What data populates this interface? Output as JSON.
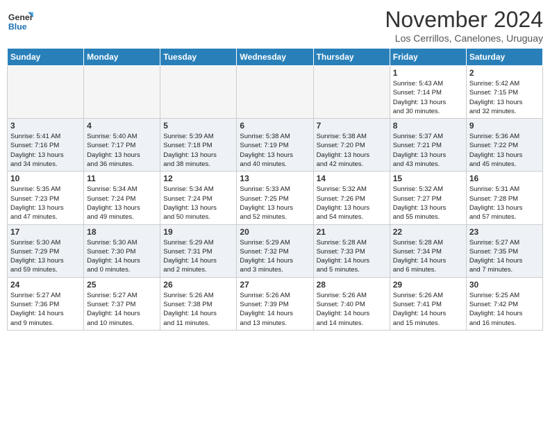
{
  "header": {
    "logo_line1": "General",
    "logo_line2": "Blue",
    "month": "November 2024",
    "location": "Los Cerrillos, Canelones, Uruguay"
  },
  "weekdays": [
    "Sunday",
    "Monday",
    "Tuesday",
    "Wednesday",
    "Thursday",
    "Friday",
    "Saturday"
  ],
  "weeks": [
    [
      {
        "day": "",
        "info": ""
      },
      {
        "day": "",
        "info": ""
      },
      {
        "day": "",
        "info": ""
      },
      {
        "day": "",
        "info": ""
      },
      {
        "day": "",
        "info": ""
      },
      {
        "day": "1",
        "info": "Sunrise: 5:43 AM\nSunset: 7:14 PM\nDaylight: 13 hours\nand 30 minutes."
      },
      {
        "day": "2",
        "info": "Sunrise: 5:42 AM\nSunset: 7:15 PM\nDaylight: 13 hours\nand 32 minutes."
      }
    ],
    [
      {
        "day": "3",
        "info": "Sunrise: 5:41 AM\nSunset: 7:16 PM\nDaylight: 13 hours\nand 34 minutes."
      },
      {
        "day": "4",
        "info": "Sunrise: 5:40 AM\nSunset: 7:17 PM\nDaylight: 13 hours\nand 36 minutes."
      },
      {
        "day": "5",
        "info": "Sunrise: 5:39 AM\nSunset: 7:18 PM\nDaylight: 13 hours\nand 38 minutes."
      },
      {
        "day": "6",
        "info": "Sunrise: 5:38 AM\nSunset: 7:19 PM\nDaylight: 13 hours\nand 40 minutes."
      },
      {
        "day": "7",
        "info": "Sunrise: 5:38 AM\nSunset: 7:20 PM\nDaylight: 13 hours\nand 42 minutes."
      },
      {
        "day": "8",
        "info": "Sunrise: 5:37 AM\nSunset: 7:21 PM\nDaylight: 13 hours\nand 43 minutes."
      },
      {
        "day": "9",
        "info": "Sunrise: 5:36 AM\nSunset: 7:22 PM\nDaylight: 13 hours\nand 45 minutes."
      }
    ],
    [
      {
        "day": "10",
        "info": "Sunrise: 5:35 AM\nSunset: 7:23 PM\nDaylight: 13 hours\nand 47 minutes."
      },
      {
        "day": "11",
        "info": "Sunrise: 5:34 AM\nSunset: 7:24 PM\nDaylight: 13 hours\nand 49 minutes."
      },
      {
        "day": "12",
        "info": "Sunrise: 5:34 AM\nSunset: 7:24 PM\nDaylight: 13 hours\nand 50 minutes."
      },
      {
        "day": "13",
        "info": "Sunrise: 5:33 AM\nSunset: 7:25 PM\nDaylight: 13 hours\nand 52 minutes."
      },
      {
        "day": "14",
        "info": "Sunrise: 5:32 AM\nSunset: 7:26 PM\nDaylight: 13 hours\nand 54 minutes."
      },
      {
        "day": "15",
        "info": "Sunrise: 5:32 AM\nSunset: 7:27 PM\nDaylight: 13 hours\nand 55 minutes."
      },
      {
        "day": "16",
        "info": "Sunrise: 5:31 AM\nSunset: 7:28 PM\nDaylight: 13 hours\nand 57 minutes."
      }
    ],
    [
      {
        "day": "17",
        "info": "Sunrise: 5:30 AM\nSunset: 7:29 PM\nDaylight: 13 hours\nand 59 minutes."
      },
      {
        "day": "18",
        "info": "Sunrise: 5:30 AM\nSunset: 7:30 PM\nDaylight: 14 hours\nand 0 minutes."
      },
      {
        "day": "19",
        "info": "Sunrise: 5:29 AM\nSunset: 7:31 PM\nDaylight: 14 hours\nand 2 minutes."
      },
      {
        "day": "20",
        "info": "Sunrise: 5:29 AM\nSunset: 7:32 PM\nDaylight: 14 hours\nand 3 minutes."
      },
      {
        "day": "21",
        "info": "Sunrise: 5:28 AM\nSunset: 7:33 PM\nDaylight: 14 hours\nand 5 minutes."
      },
      {
        "day": "22",
        "info": "Sunrise: 5:28 AM\nSunset: 7:34 PM\nDaylight: 14 hours\nand 6 minutes."
      },
      {
        "day": "23",
        "info": "Sunrise: 5:27 AM\nSunset: 7:35 PM\nDaylight: 14 hours\nand 7 minutes."
      }
    ],
    [
      {
        "day": "24",
        "info": "Sunrise: 5:27 AM\nSunset: 7:36 PM\nDaylight: 14 hours\nand 9 minutes."
      },
      {
        "day": "25",
        "info": "Sunrise: 5:27 AM\nSunset: 7:37 PM\nDaylight: 14 hours\nand 10 minutes."
      },
      {
        "day": "26",
        "info": "Sunrise: 5:26 AM\nSunset: 7:38 PM\nDaylight: 14 hours\nand 11 minutes."
      },
      {
        "day": "27",
        "info": "Sunrise: 5:26 AM\nSunset: 7:39 PM\nDaylight: 14 hours\nand 13 minutes."
      },
      {
        "day": "28",
        "info": "Sunrise: 5:26 AM\nSunset: 7:40 PM\nDaylight: 14 hours\nand 14 minutes."
      },
      {
        "day": "29",
        "info": "Sunrise: 5:26 AM\nSunset: 7:41 PM\nDaylight: 14 hours\nand 15 minutes."
      },
      {
        "day": "30",
        "info": "Sunrise: 5:25 AM\nSunset: 7:42 PM\nDaylight: 14 hours\nand 16 minutes."
      }
    ]
  ]
}
